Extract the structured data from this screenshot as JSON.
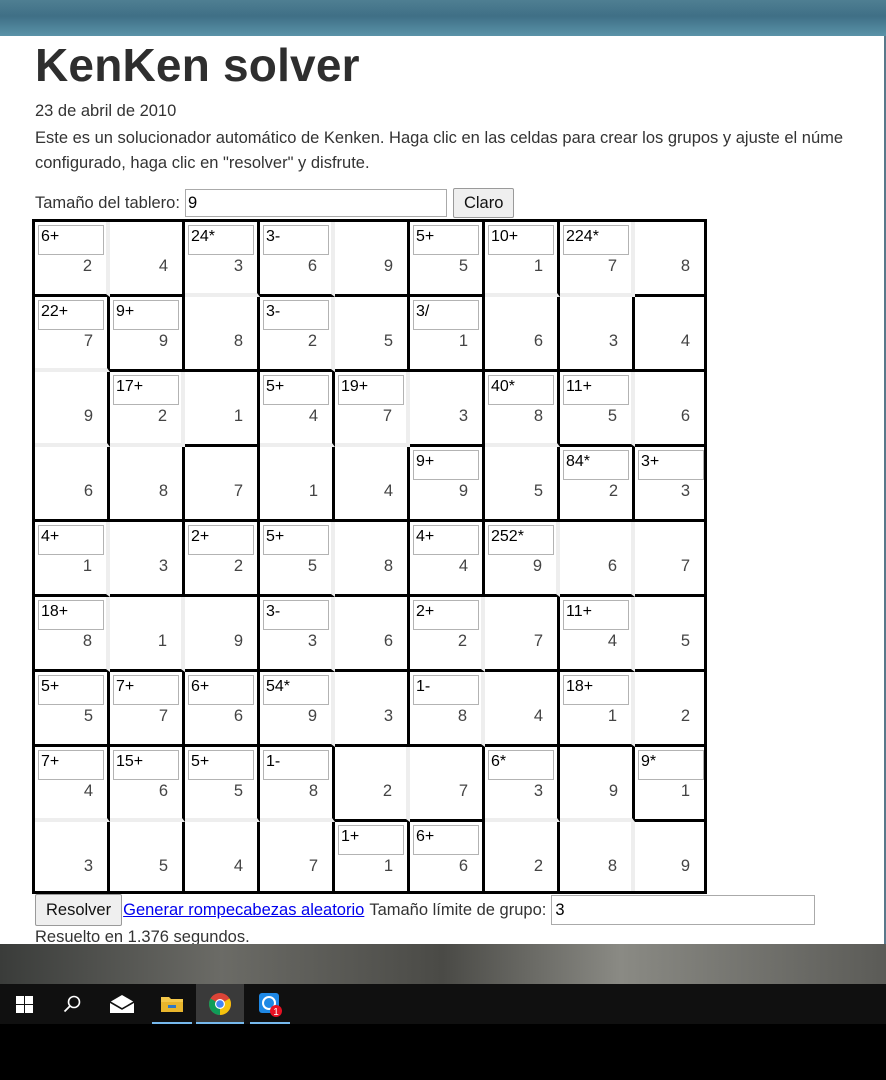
{
  "page": {
    "title": "KenKen solver",
    "date": "23 de abril de 2010",
    "description_line1": "Este es un solucionador automático de Kenken. Haga clic en las celdas para crear los grupos y ajuste el núme",
    "description_line2": "configurado, haga clic en \"resolver\" y disfrute.",
    "board_size_label": "Tamaño del tablero:",
    "board_size_value": "9",
    "clear_button": "Claro",
    "solve_button": "Resolver",
    "random_link": "Generar rompecabezas aleatorio",
    "group_limit_label": "Tamaño límite de grupo:",
    "group_limit_value": "3",
    "status": "Resuelto en 1.376 segundos."
  },
  "board": {
    "size": 9,
    "values": [
      [
        2,
        4,
        3,
        6,
        9,
        5,
        1,
        7,
        8
      ],
      [
        7,
        9,
        8,
        2,
        5,
        1,
        6,
        3,
        4
      ],
      [
        9,
        2,
        1,
        4,
        7,
        3,
        8,
        5,
        6
      ],
      [
        6,
        8,
        7,
        1,
        4,
        9,
        5,
        2,
        3
      ],
      [
        1,
        3,
        2,
        5,
        8,
        4,
        9,
        6,
        7
      ],
      [
        8,
        1,
        9,
        3,
        6,
        2,
        7,
        4,
        5
      ],
      [
        5,
        7,
        6,
        9,
        3,
        8,
        4,
        1,
        2
      ],
      [
        4,
        6,
        5,
        8,
        2,
        7,
        3,
        9,
        1
      ],
      [
        3,
        5,
        4,
        7,
        1,
        6,
        2,
        8,
        9
      ]
    ],
    "cage_labels": [
      [
        "6+",
        "",
        "24*",
        "3-",
        "",
        "5+",
        "10+",
        "224*",
        ""
      ],
      [
        "22+",
        "9+",
        "",
        "3-",
        "",
        "3/",
        "",
        "",
        ""
      ],
      [
        "",
        "17+",
        "",
        "5+",
        "19+",
        "",
        "40*",
        "11+",
        ""
      ],
      [
        "",
        "",
        "",
        "",
        "",
        "9+",
        "",
        "84*",
        "3+"
      ],
      [
        "4+",
        "",
        "2+",
        "5+",
        "",
        "4+",
        "252*",
        "",
        ""
      ],
      [
        "18+",
        "",
        "",
        "3-",
        "",
        "2+",
        "",
        "11+",
        ""
      ],
      [
        "5+",
        "7+",
        "6+",
        "54*",
        "",
        "1-",
        "",
        "18+",
        ""
      ],
      [
        "7+",
        "15+",
        "5+",
        "1-",
        "",
        "",
        "6*",
        "",
        "9*"
      ],
      [
        "",
        "",
        "",
        "",
        "1+",
        "6+",
        "",
        "",
        ""
      ]
    ],
    "cages": [
      [
        1,
        1,
        2,
        3,
        3,
        4,
        5,
        6,
        6
      ],
      [
        7,
        8,
        2,
        9,
        9,
        10,
        5,
        6,
        11
      ],
      [
        7,
        12,
        12,
        13,
        14,
        14,
        15,
        16,
        16
      ],
      [
        7,
        12,
        17,
        13,
        14,
        18,
        15,
        19,
        20
      ],
      [
        21,
        21,
        22,
        23,
        23,
        24,
        25,
        25,
        25
      ],
      [
        26,
        26,
        26,
        27,
        27,
        28,
        28,
        29,
        29
      ],
      [
        30,
        31,
        32,
        33,
        33,
        34,
        34,
        35,
        35
      ],
      [
        36,
        37,
        38,
        39,
        40,
        40,
        41,
        42,
        43
      ],
      [
        36,
        37,
        38,
        39,
        44,
        45,
        41,
        42,
        42
      ]
    ]
  },
  "taskbar": {
    "items": [
      "start",
      "search",
      "mail",
      "file-explorer",
      "chrome",
      "app-with-badge"
    ],
    "badge_count": "1"
  }
}
